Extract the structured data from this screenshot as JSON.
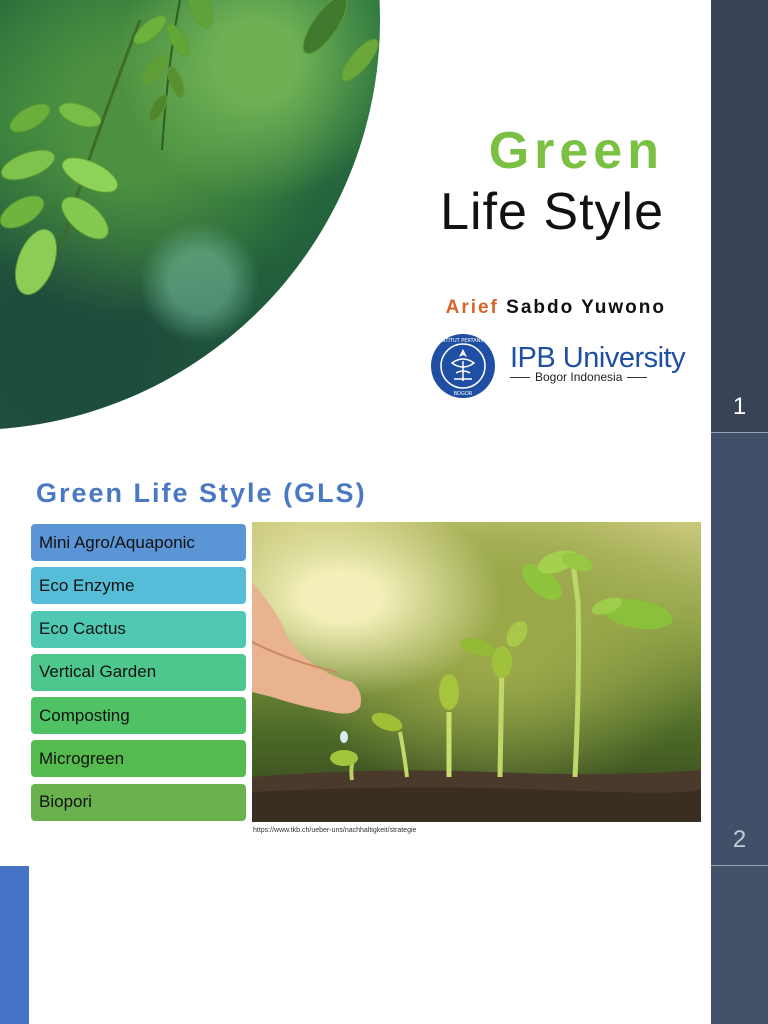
{
  "slide1": {
    "title_green": "Green",
    "title_black": "Life Style",
    "author_first": "Arief",
    "author_rest": " Sabdo Yuwono",
    "university_name": "IPB University",
    "university_sub": "Bogor Indonesia",
    "seal_text": "INSTITUT PERTANIAN BOGOR",
    "slide_number": "1"
  },
  "slide2": {
    "title": "Green Life Style (GLS)",
    "items": [
      {
        "label": "Mini Agro/Aquaponic",
        "color": "#5b95d6"
      },
      {
        "label": "Eco Enzyme",
        "color": "#56bdd9"
      },
      {
        "label": "Eco Cactus",
        "color": "#4fc9b3"
      },
      {
        "label": "Vertical Garden",
        "color": "#4ec78e"
      },
      {
        "label": "Composting",
        "color": "#4fc266"
      },
      {
        "label": "Microgreen",
        "color": "#56bb4f"
      },
      {
        "label": "Biopori",
        "color": "#69b24e"
      }
    ],
    "caption": "https://www.tkb.ch/ueber-uns/nachhaltigkeit/strategie",
    "slide_number": "2"
  },
  "colors": {
    "rail": "#384356",
    "green_title": "#7ac143",
    "author_first": "#d4652c",
    "gls_title": "#4a78c2",
    "ipb_blue": "#1e4fa3",
    "slide3_accent": "#4473c5"
  }
}
